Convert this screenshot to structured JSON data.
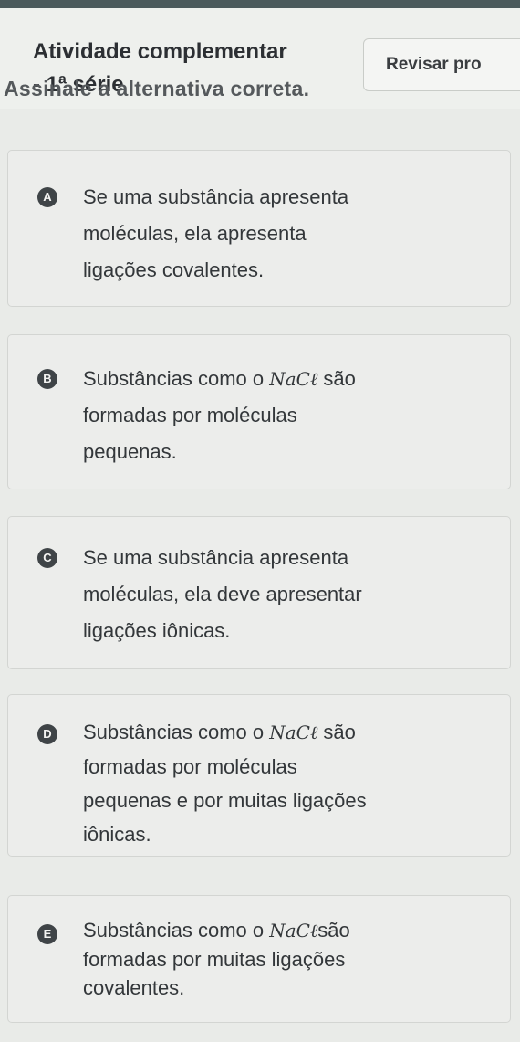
{
  "header": {
    "title_line1": "Atividade complementar",
    "title_line2": "- 1ª série",
    "review_button_label": "Revisar pro"
  },
  "instruction": "Assinale a alternativa correta.",
  "options": [
    {
      "letter": "A",
      "lines": [
        "Se uma substância apresenta",
        "moléculas, ela apresenta",
        "ligações covalentes."
      ]
    },
    {
      "letter": "B",
      "line1_before": "Substâncias como o ",
      "formula": "NaCℓ",
      "line1_after": " são",
      "lines_rest": [
        "formadas por moléculas",
        "pequenas."
      ]
    },
    {
      "letter": "C",
      "lines": [
        "Se uma substância apresenta",
        "moléculas, ela deve apresentar",
        "ligações iônicas."
      ]
    },
    {
      "letter": "D",
      "line1_before": "Substâncias como o ",
      "formula": "NaCℓ",
      "line1_after": " são",
      "lines_rest": [
        "formadas por moléculas",
        "pequenas e por muitas ligações",
        "iônicas."
      ]
    },
    {
      "letter": "E",
      "line1_before": "Substâncias como o ",
      "formula": "NaCℓ",
      "line1_after": "são",
      "lines_rest": [
        "formadas por muitas ligações",
        "covalentes."
      ]
    }
  ]
}
